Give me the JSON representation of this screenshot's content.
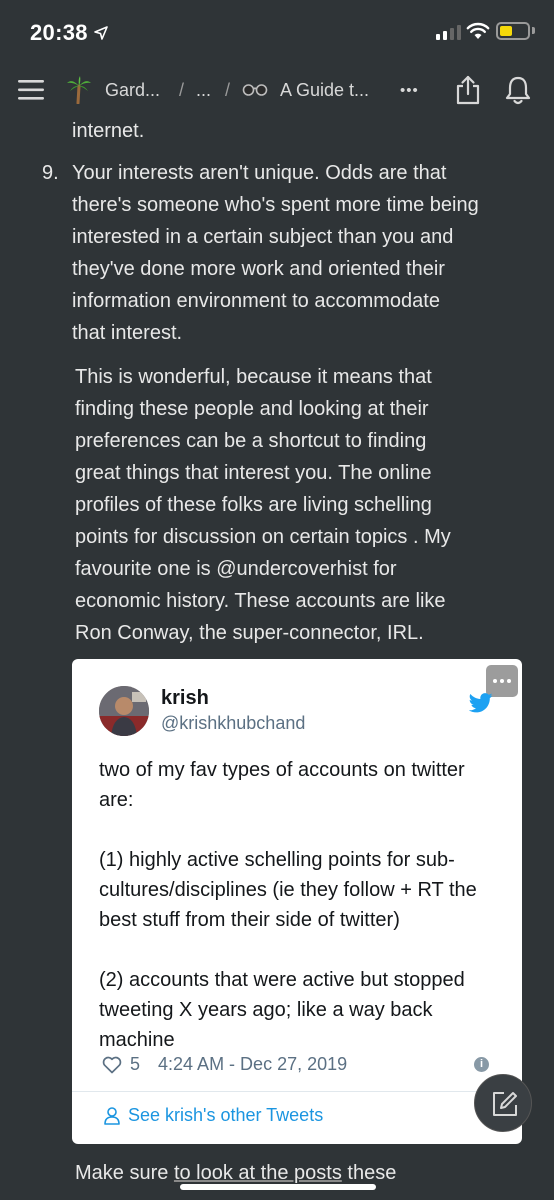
{
  "status": {
    "time": "20:38"
  },
  "nav": {
    "breadcrumb_1": "Gard...",
    "sep": "/",
    "breadcrumb_2": "...",
    "breadcrumb_3": "A Guide t...",
    "more": "•••"
  },
  "article": {
    "top_fragment": "internet.",
    "item_number": "9.",
    "item_lines": [
      "Your interests aren't unique. Odds are that",
      "there's someone who's spent more time being",
      "interested in a certain subject than you and",
      "they've done more work and oriented their",
      "information environment to accommodate",
      "that interest."
    ],
    "para_lines": [
      "This is wonderful, because it means that",
      "finding these people and looking at their",
      "preferences can be a shortcut to finding",
      "great things that interest you. The online",
      "profiles of these folks are living schelling",
      "points for discussion on certain topics . My",
      "favourite one is @undercoverhist for",
      "economic history. These accounts are like",
      "Ron Conway, the super-connector, IRL."
    ],
    "bottom_prefix": "Make sure ",
    "bottom_link": "to look at the posts",
    "bottom_suffix": " these"
  },
  "tweet": {
    "name": "krish",
    "handle": "@krishkhubchand",
    "text": "two of my fav types of accounts on twitter are:\n\n(1) highly active schelling points for sub-cultures/disciplines (ie they follow + RT the best stuff from their side of twitter)\n\n(2) accounts that were active but stopped tweeting X years ago; like a way back machine",
    "likes": "5",
    "timestamp": "4:24 AM - Dec 27, 2019",
    "see_more": "See krish's other Tweets"
  },
  "colors": {
    "background": "#2f3437",
    "link": "#1b95e0",
    "twitter": "#1da1f2"
  }
}
